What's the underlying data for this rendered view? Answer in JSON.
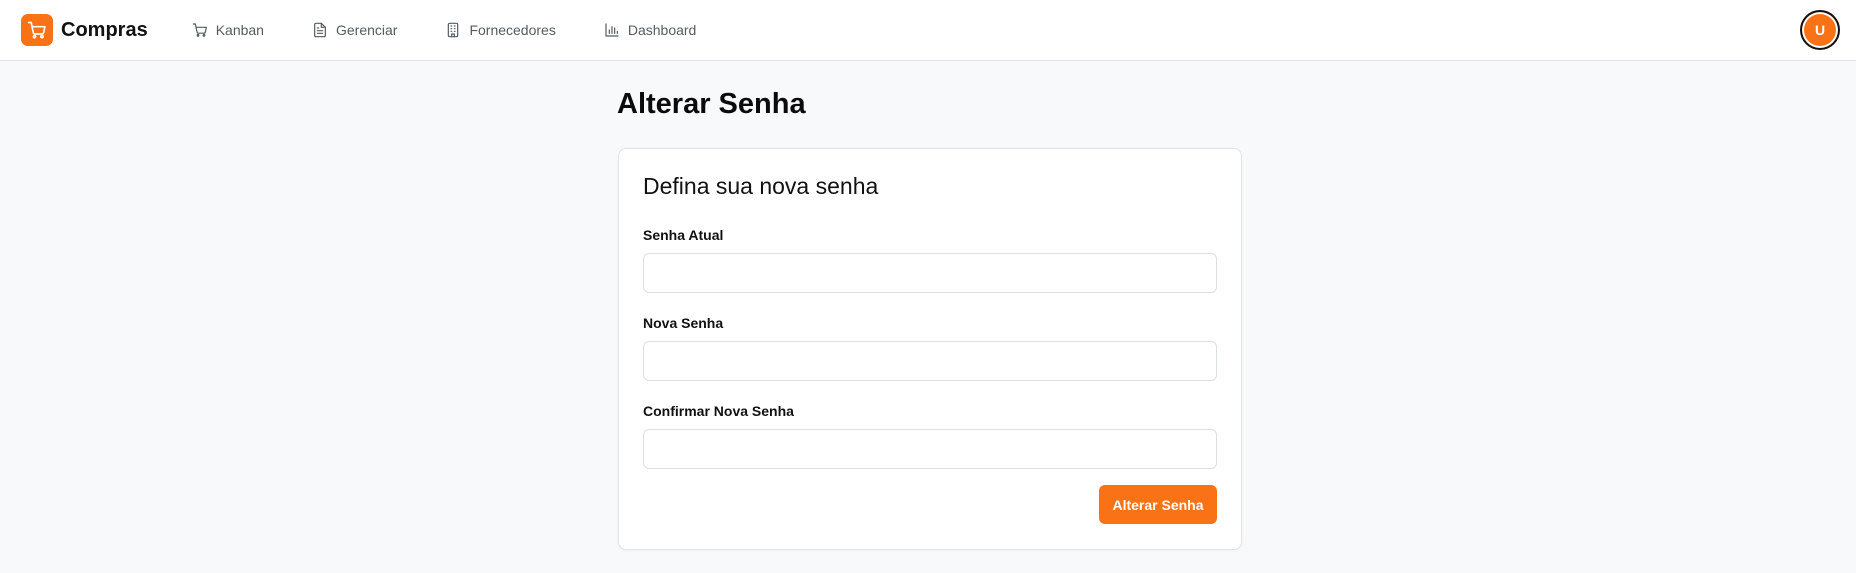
{
  "app": {
    "name": "Compras",
    "logo_icon": "shopping-cart-icon",
    "accent_color": "#f97316"
  },
  "nav": {
    "items": [
      {
        "label": "Kanban",
        "icon": "shopping-cart-icon"
      },
      {
        "label": "Gerenciar",
        "icon": "document-icon"
      },
      {
        "label": "Fornecedores",
        "icon": "building-icon"
      },
      {
        "label": "Dashboard",
        "icon": "bar-chart-icon"
      }
    ]
  },
  "user": {
    "avatar_initial": "U"
  },
  "page": {
    "title": "Alterar Senha"
  },
  "form": {
    "heading": "Defina sua nova senha",
    "fields": [
      {
        "label": "Senha Atual",
        "value": "",
        "placeholder": ""
      },
      {
        "label": "Nova Senha",
        "value": "",
        "placeholder": ""
      },
      {
        "label": "Confirmar Nova Senha",
        "value": "",
        "placeholder": ""
      }
    ],
    "submit_label": "Alterar Senha"
  }
}
